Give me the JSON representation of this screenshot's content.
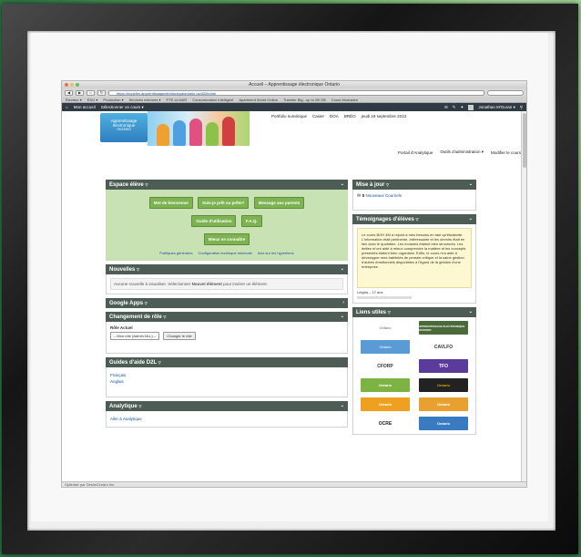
{
  "window": {
    "title": "Accueil – Apprentissage électronique Ontario"
  },
  "browser": {
    "url": "https://equelim.apprentissageelectroniqueontario.ca/d2l/home",
    "bookmarks": [
      "Électeur ▾",
      "EDU ▾",
      "Production ▾",
      "Services externes ▾",
      "PTE-ULNAR",
      "Consommation Intelligent",
      "Apartment World Online",
      "Transfer Big...up to 2B GB",
      "Cours Modulaire"
    ]
  },
  "navbar": {
    "home": "Mon accueil",
    "select_course": "Sélectionner un cours ▾",
    "user": "Jonathan M'Guran ▾"
  },
  "header": {
    "logo_lines": [
      "Apprentissage",
      "électronique",
      "ONTARIO"
    ],
    "links": [
      "Portfolio numérique",
      "Casier",
      "DOA",
      "BRÉO",
      "jeudi 19 septembre 2013"
    ]
  },
  "sublinks": [
    "Portail d'Analytique",
    "Outils d'administration ▾",
    "Modifier le cours"
  ],
  "espace": {
    "title": "Espace élève",
    "buttons_row1": [
      "Mot de bienvenue",
      "Suis-je prêt ou prête?",
      "Message aux parents"
    ],
    "buttons_row2": [
      "Guide d'utilisation",
      "F.A.Q."
    ],
    "buttons_row3": [
      "Mieux se connaître"
    ],
    "links": [
      "Politiques générales",
      "Configuration technique minimale",
      "Avis sur les hyperliens"
    ]
  },
  "nouvelles": {
    "title": "Nouvelles",
    "text": "Aucune nouvelle à visualiser. Sélectionner",
    "bold": "Nouvel élément",
    "text2": "pour insérer un élément."
  },
  "google_apps": {
    "title": "Google Apps"
  },
  "changement": {
    "title": "Changement de rôle",
    "label": "Rôle Actuel",
    "select": "– Mon rôle (Admin-NLL) –",
    "button": "Changer le rôle"
  },
  "guides": {
    "title": "Guides d'aide D2L",
    "links": [
      "Français",
      "Anglais"
    ]
  },
  "analytique": {
    "title": "Analytique",
    "link": "Aller à Analytique"
  },
  "mises": {
    "title": "Mise à jour",
    "item": "Nouveaux Courriels",
    "count": "8"
  },
  "temoignages": {
    "title": "Témoignages d'élèves",
    "text": "Le cours BOH 4M a rejoint à mes besoins en tant qu'étudiante. L'information était pertinente, intéressante et les devoirs était en lien avec le quotidien. Les modules étaient bien structurés. Les dettes m'ont aidé à mieux comprendre la matière et les concepts présentés étaient bien organisés. Enfin, le cours m'a aidé à développer mes habiletés de pensée critique et la saine gestion d'autres émotionnels disponibles à l'égard de la gestion d'une entreprise.",
    "author": "Leigha – 17 ans"
  },
  "liens": {
    "title": "Liens utiles",
    "logos": [
      "Ontario",
      "APPRENTISSAGE ÉLECTRONIQUE ONTARIO",
      "Ontario",
      "CAVLFO",
      "CFORP",
      "TFO",
      "Ontario",
      "Ontario",
      "Ontario",
      "Ontario",
      "OCRE",
      "Ontario"
    ]
  },
  "status": "Optimisé par Desire2Learn Inc.",
  "colors": {
    "panel_header": "#4d5d56",
    "green_button": "#7eb352",
    "espace_bg": "#c8e2b4",
    "nav": "#2f3a45"
  }
}
